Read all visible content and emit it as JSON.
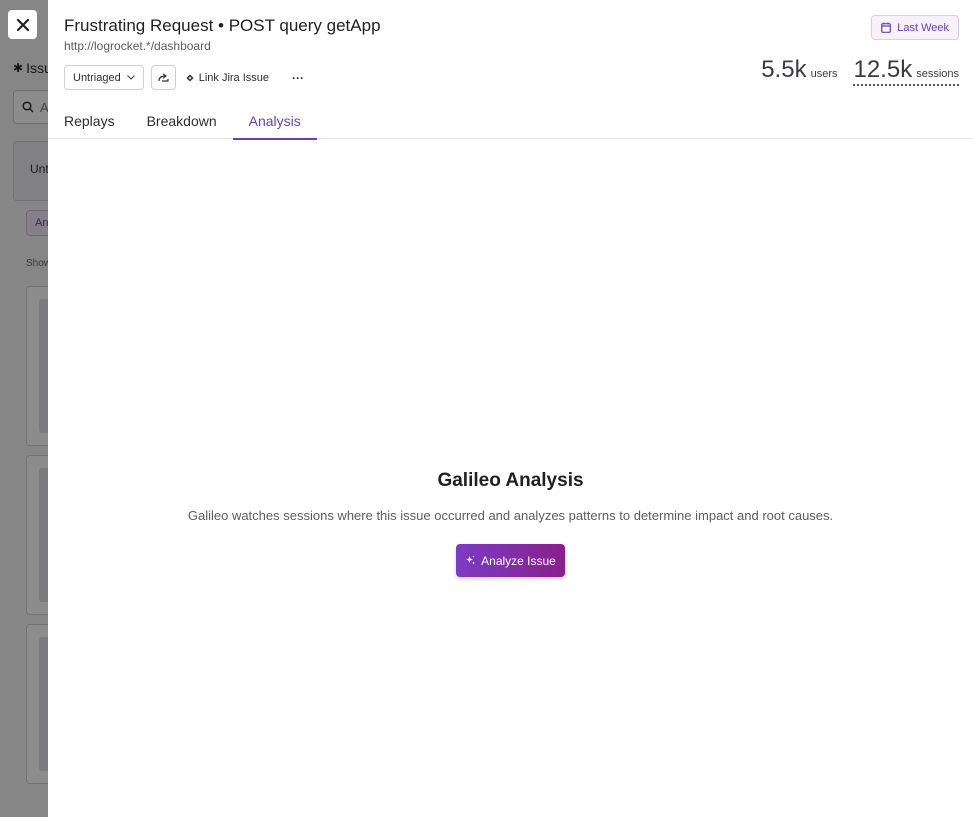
{
  "background": {
    "page_title": "Issu",
    "search_placeholder": "A",
    "panel_label": "Unt",
    "chip_label": "An",
    "show_label": "Show"
  },
  "close_button": {
    "icon": "close-icon"
  },
  "header": {
    "title": "Frustrating Request • POST query getApp",
    "url": "http://logrocket.*/dashboard",
    "date_range": "Last Week"
  },
  "actions": {
    "status": "Untriaged",
    "share_icon": "share-icon",
    "link_jira": "Link Jira Issue",
    "more": "···"
  },
  "stats": {
    "users_value": "5.5k",
    "users_label": "users",
    "sessions_value": "12.5k",
    "sessions_label": "sessions"
  },
  "tabs": [
    {
      "label": "Replays"
    },
    {
      "label": "Breakdown"
    },
    {
      "label": "Analysis",
      "active": true
    }
  ],
  "analysis": {
    "title": "Galileo Analysis",
    "description": "Galileo watches sessions where this issue occurred and analyzes patterns to determine impact and root causes.",
    "button_label": "Analyze Issue"
  },
  "colors": {
    "accent": "#6b3fb6",
    "button_gradient_start": "#7a3cc4",
    "button_gradient_end": "#8a1f8c"
  }
}
